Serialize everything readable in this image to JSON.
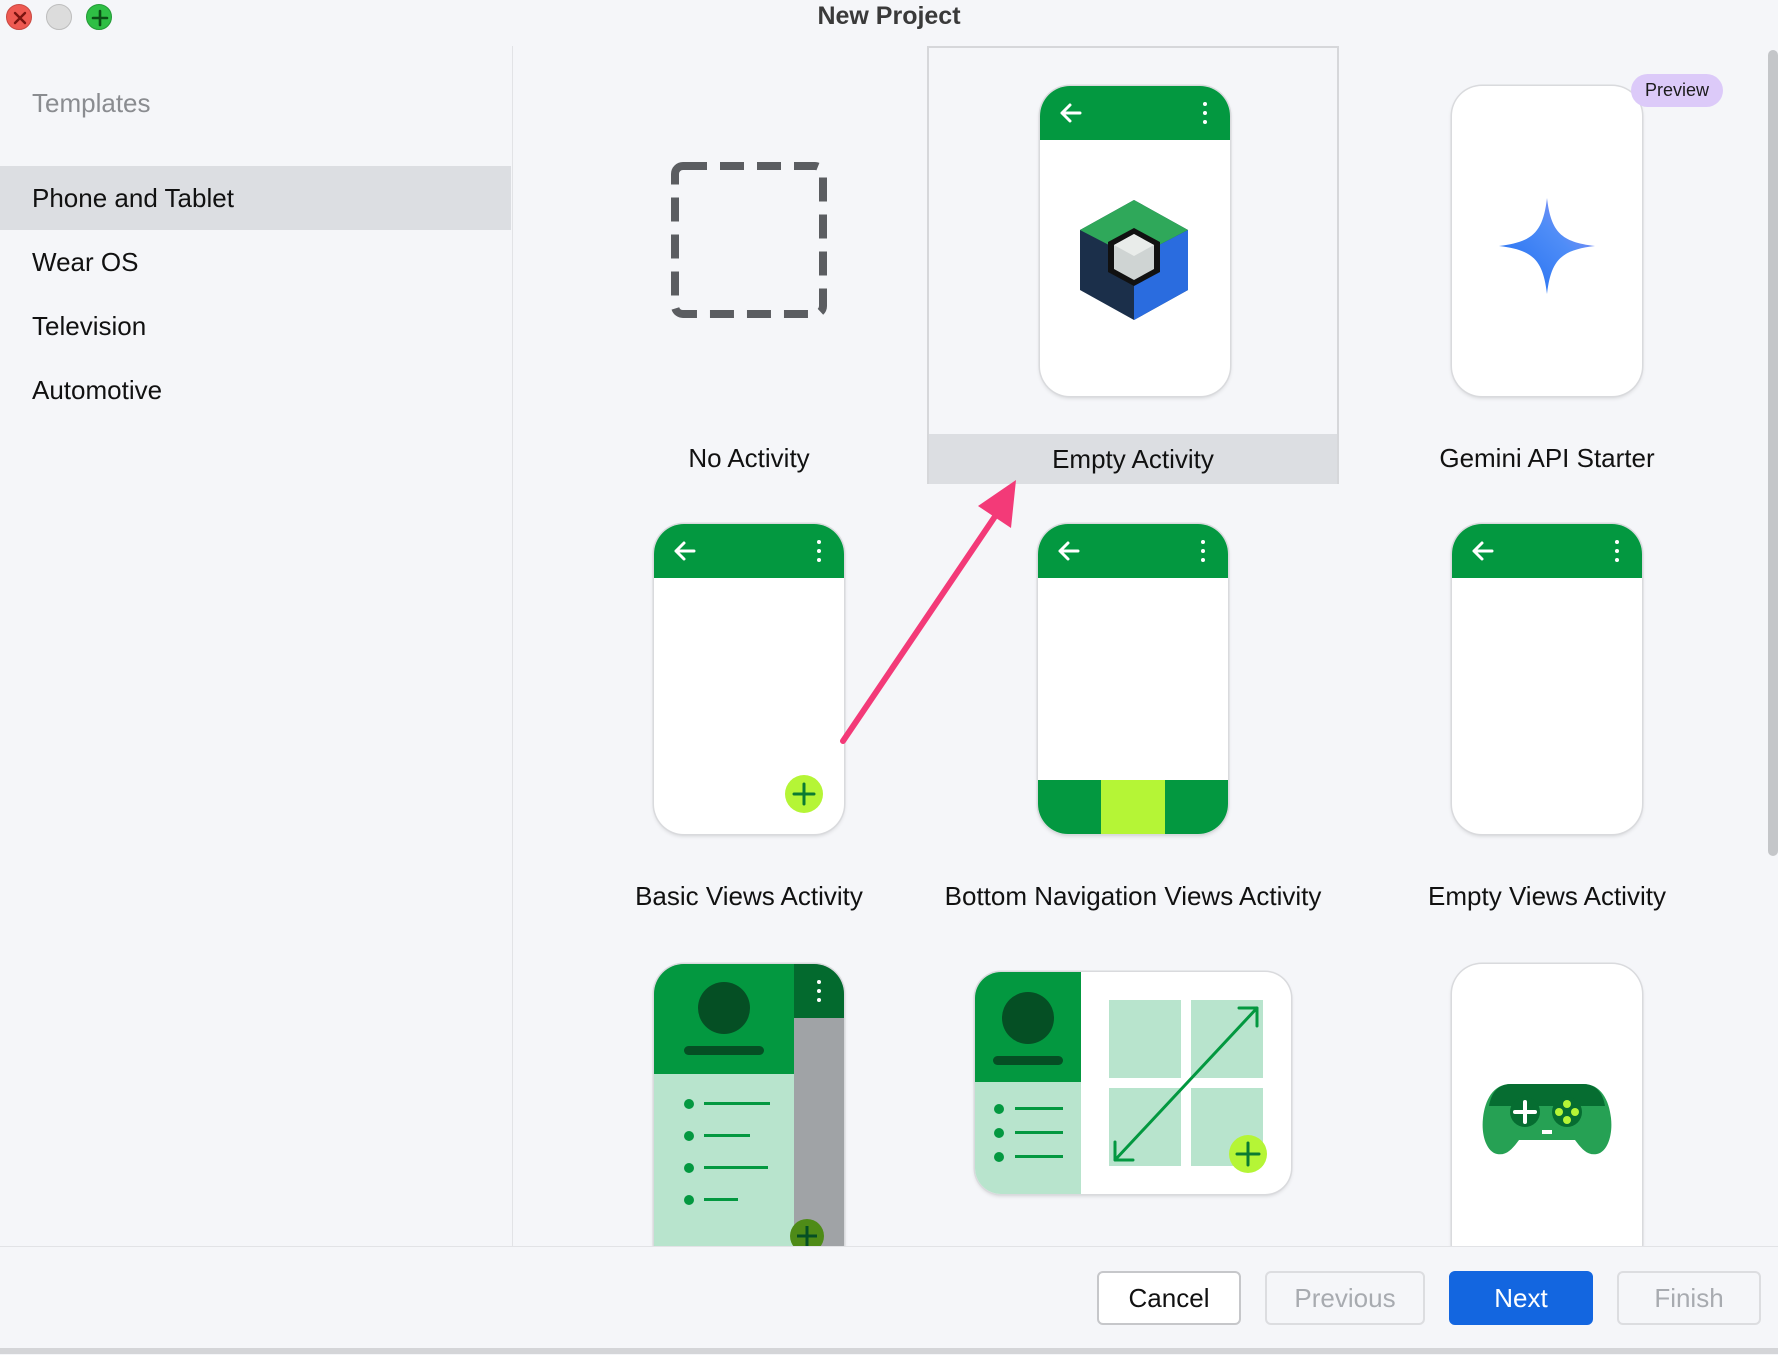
{
  "window": {
    "title": "New Project"
  },
  "sidebar": {
    "heading": "Templates",
    "items": [
      {
        "label": "Phone and Tablet",
        "selected": true
      },
      {
        "label": "Wear OS",
        "selected": false
      },
      {
        "label": "Television",
        "selected": false
      },
      {
        "label": "Automotive",
        "selected": false
      }
    ]
  },
  "templates": {
    "tiles": [
      {
        "label": "No Activity",
        "icon": "dashed-square-icon"
      },
      {
        "label": "Empty Activity",
        "icon": "compose-cube-icon",
        "selected": true
      },
      {
        "label": "Gemini API Starter",
        "icon": "gemini-star-icon",
        "badge": "Preview"
      },
      {
        "label": "Basic Views Activity",
        "icon": "fab-plus-icon"
      },
      {
        "label": "Bottom Navigation Views Activity",
        "icon": "bottom-nav-icon"
      },
      {
        "label": "Empty Views Activity",
        "icon": "blank-phone-icon"
      },
      {
        "label": "",
        "icon": "navigation-drawer-icon"
      },
      {
        "label": "",
        "icon": "responsive-layout-icon"
      },
      {
        "label": "",
        "icon": "game-controller-icon"
      }
    ]
  },
  "footer": {
    "cancel": "Cancel",
    "previous": "Previous",
    "next": "Next",
    "finish": "Finish"
  },
  "colors": {
    "accent": "#1366e0",
    "android_green": "#039840",
    "lime": "#b5f536",
    "annotation": "#f33a78"
  }
}
